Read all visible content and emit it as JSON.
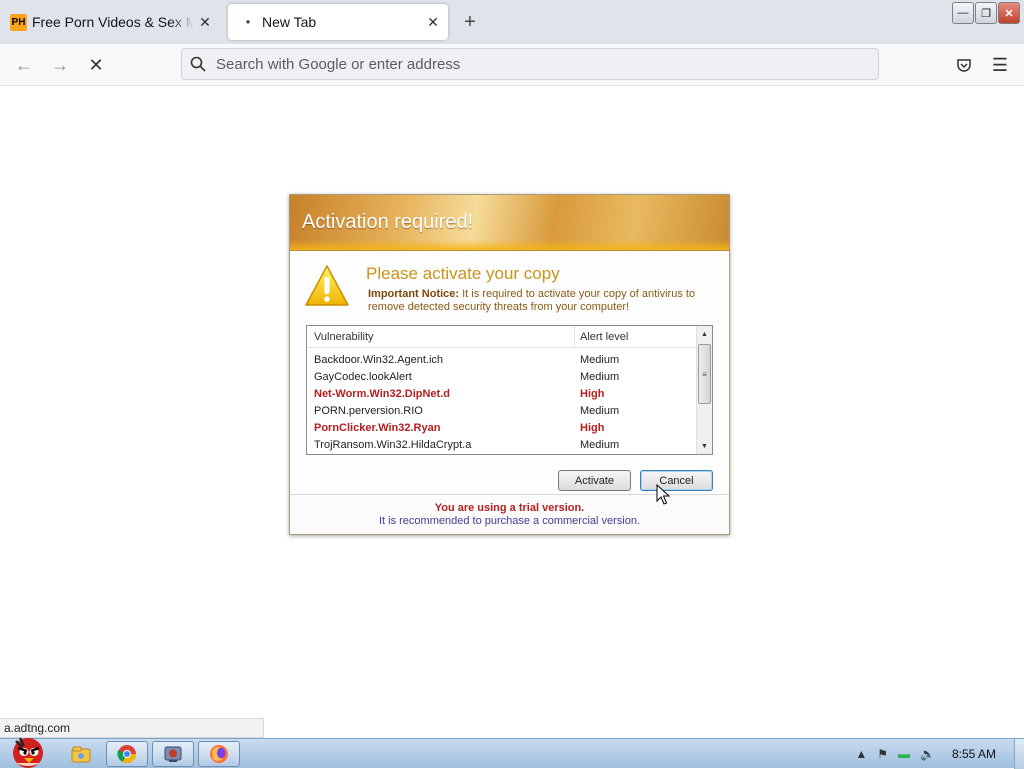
{
  "browser": {
    "tabs": [
      {
        "label": "Free Porn Videos & Sex Movies",
        "favicon": "PH"
      },
      {
        "label": "New Tab"
      }
    ],
    "url_placeholder": "Search with Google or enter address"
  },
  "dialog": {
    "title": "Activation required!",
    "heading": "Please activate your copy",
    "notice_bold": "Important Notice:",
    "notice_text": " It is required to activate your copy of antivirus to remove detected security threats from your computer!",
    "columns": [
      "Vulnerability",
      "Alert level"
    ],
    "rows": [
      {
        "name": "Backdoor.Win32.Agent.ich",
        "level": "Medium",
        "high": false
      },
      {
        "name": "GayCodec.lookAlert",
        "level": "Medium",
        "high": false
      },
      {
        "name": "Net-Worm.Win32.DipNet.d",
        "level": "High",
        "high": true
      },
      {
        "name": "PORN.perversion.RIO",
        "level": "Medium",
        "high": false
      },
      {
        "name": "PornClicker.Win32.Ryan",
        "level": "High",
        "high": true
      },
      {
        "name": "TrojRansom.Win32.HildaCrypt.a",
        "level": "Medium",
        "high": false
      }
    ],
    "activate_label": "Activate",
    "cancel_label": "Cancel",
    "trial_text": "You are using a trial version.",
    "recommend_text": "It is recommended to purchase a commercial version."
  },
  "status_url": "a.adtng.com",
  "taskbar": {
    "clock": "8:55 AM",
    "items": [
      "explorer-icon",
      "chrome-icon",
      "app-icon",
      "firefox-icon"
    ]
  },
  "colors": {
    "high_alert": "#b52020",
    "header_gold": "#e6b25a",
    "heading_gold": "#c8941a"
  }
}
